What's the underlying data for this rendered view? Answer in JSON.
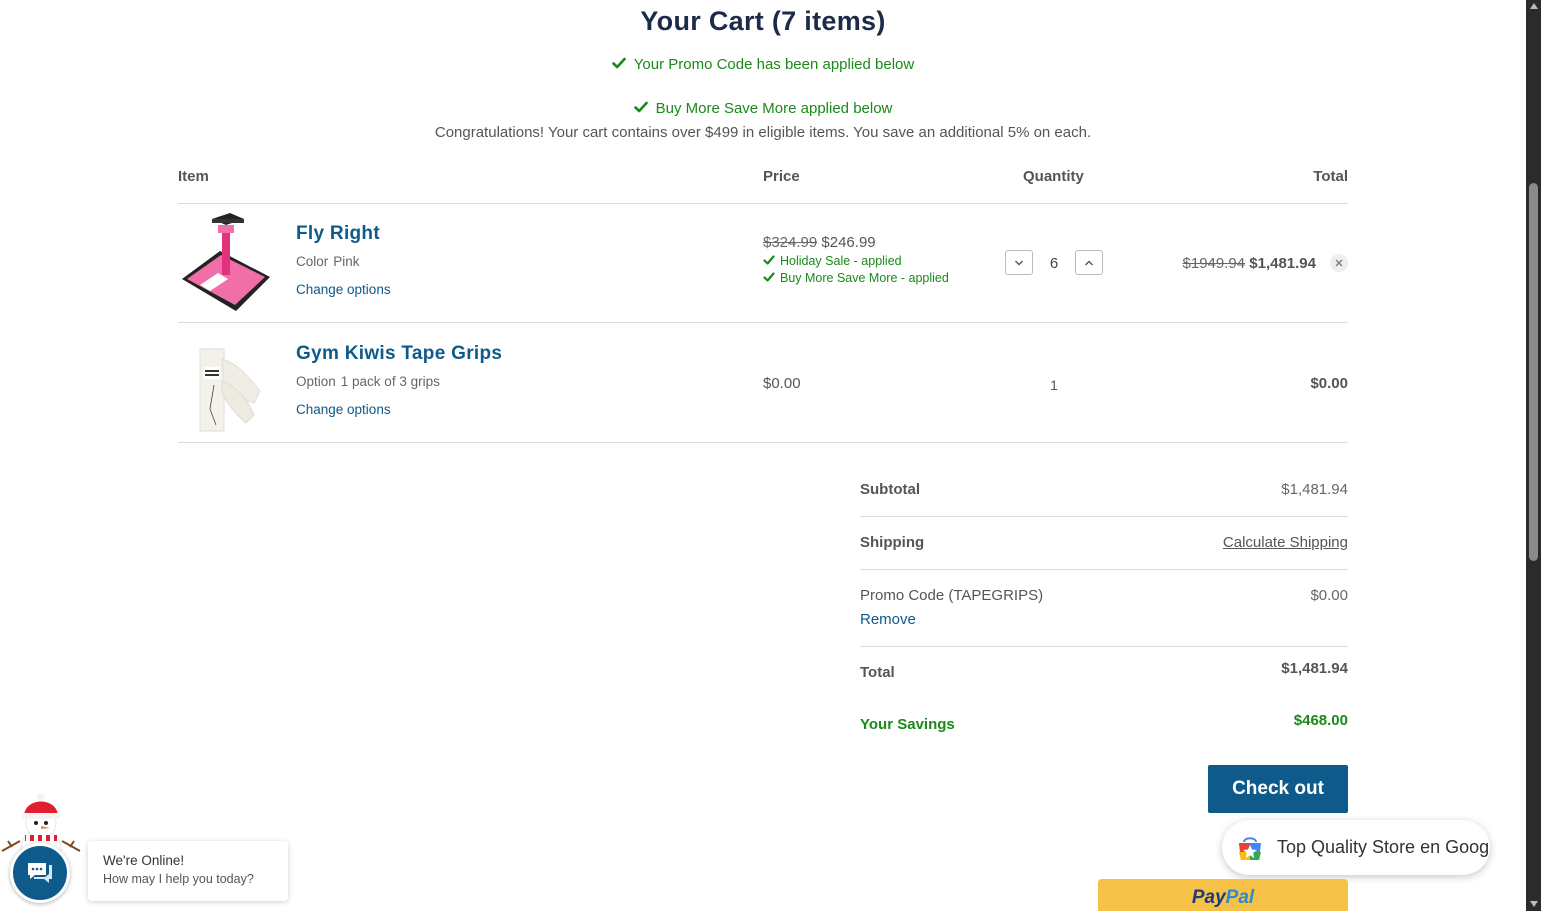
{
  "page": {
    "title": "Your Cart (7 items)"
  },
  "notices": {
    "promo": "Your Promo Code has been applied below",
    "bmsm": "Buy More Save More applied below",
    "congrats": "Congratulations! Your cart contains over $499 in eligible items. You save an additional 5% on each."
  },
  "table": {
    "headers": {
      "item": "Item",
      "price": "Price",
      "quantity": "Quantity",
      "total": "Total"
    }
  },
  "items": [
    {
      "name": "Fly Right",
      "option_label": "Color",
      "option_value": "Pink",
      "change_options": "Change options",
      "original_price": "$324.99",
      "price": "$246.99",
      "discounts": [
        "Holiday Sale - applied",
        "Buy More Save More - applied"
      ],
      "quantity": "6",
      "original_total": "$1949.94",
      "total": "$1,481.94"
    },
    {
      "name": "Gym Kiwis Tape Grips",
      "option_label": "Option",
      "option_value": "1 pack of 3 grips",
      "change_options": "Change options",
      "price": "$0.00",
      "quantity": "1",
      "total": "$0.00"
    }
  ],
  "summary": {
    "subtotal_label": "Subtotal",
    "subtotal_value": "$1,481.94",
    "shipping_label": "Shipping",
    "shipping_value": "Calculate Shipping",
    "promo_label": "Promo Code (TAPEGRIPS)",
    "promo_value": "$0.00",
    "promo_remove": "Remove",
    "total_label": "Total",
    "total_value": "$1,481.94",
    "savings_label": "Your Savings",
    "savings_value": "$468.00"
  },
  "checkout_label": "Check out",
  "store_badge": "Top Quality Store en Google",
  "paypal": {
    "part1": "Pay",
    "part2": "Pal"
  },
  "chat": {
    "status": "We're Online!",
    "prompt": "How may I help you today?"
  },
  "colors": {
    "brand": "#0e5a8a",
    "success": "#1a8a1a",
    "title": "#1c2b4a",
    "paypal": "#f5c146"
  }
}
